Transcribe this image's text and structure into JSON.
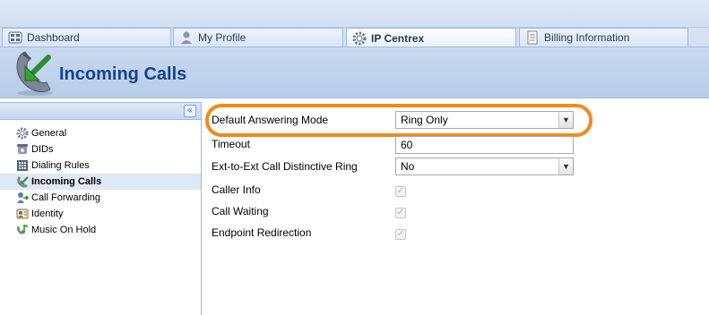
{
  "tabs": [
    {
      "label": "Dashboard",
      "icon": "dashboard-icon"
    },
    {
      "label": "My Profile",
      "icon": "user-profile-icon"
    },
    {
      "label": "IP Centrex",
      "icon": "gear-icon",
      "active": true
    },
    {
      "label": "Billing Information",
      "icon": "document-icon"
    }
  ],
  "header": {
    "title": "Incoming Calls",
    "icon": "incoming-call-phone-icon"
  },
  "sidebar": {
    "collapse_glyph": "«",
    "items": [
      {
        "label": "General",
        "icon": "gear-icon"
      },
      {
        "label": "DIDs",
        "icon": "phone-icon"
      },
      {
        "label": "Dialing Rules",
        "icon": "keypad-icon"
      },
      {
        "label": "Incoming Calls",
        "icon": "incoming-call-icon",
        "active": true
      },
      {
        "label": "Call Forwarding",
        "icon": "call-forward-icon"
      },
      {
        "label": "Identity",
        "icon": "identity-icon"
      },
      {
        "label": "Music On Hold",
        "icon": "music-icon"
      }
    ]
  },
  "form": {
    "default_answering_mode": {
      "label": "Default Answering Mode",
      "value": "Ring Only"
    },
    "timeout": {
      "label": "Timeout",
      "value": "60"
    },
    "distinctive_ring": {
      "label": "Ext-to-Ext Call Distinctive Ring",
      "value": "No"
    },
    "caller_info": {
      "label": "Caller Info",
      "checked": true
    },
    "call_waiting": {
      "label": "Call Waiting",
      "checked": true
    },
    "endpoint_redirection": {
      "label": "Endpoint Redirection",
      "checked": true
    }
  },
  "colors": {
    "highlight": "#f28a1c",
    "title": "#15428b",
    "active_nav": "#dfe8f6"
  }
}
